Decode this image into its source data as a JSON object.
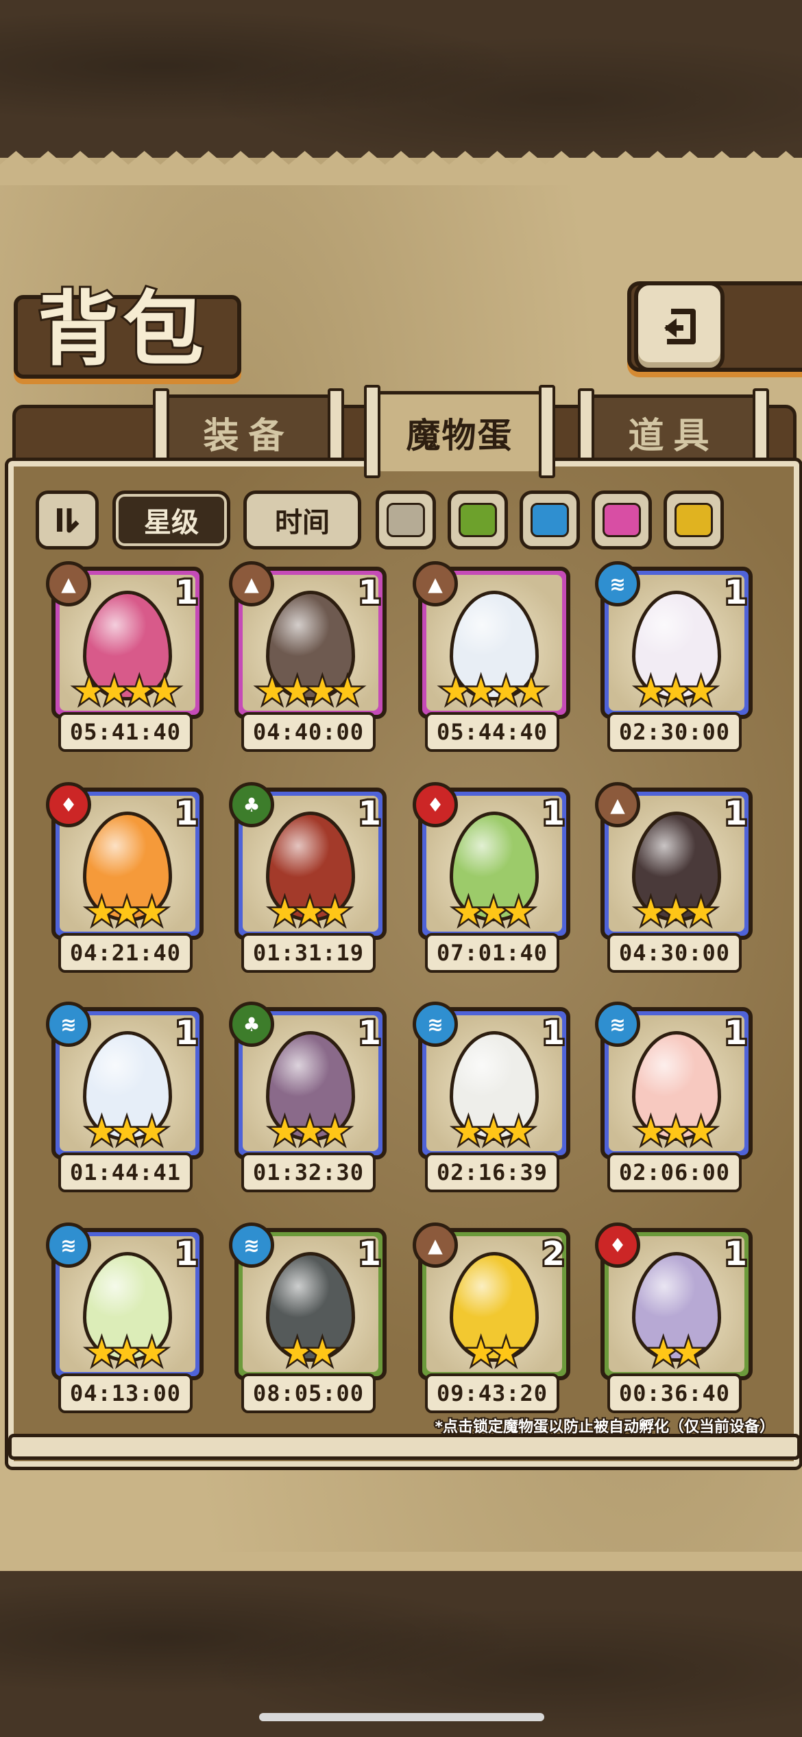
{
  "title": "背包",
  "tabs": [
    {
      "label": "装备",
      "active": false
    },
    {
      "label": "魔物蛋",
      "active": true
    },
    {
      "label": "道具",
      "active": false
    }
  ],
  "sort": {
    "star_label": "星级",
    "time_label": "时间",
    "active": "星级"
  },
  "color_filters": [
    "#b5ab95",
    "#6da12c",
    "#2f8fd0",
    "#d84ea4",
    "#e0b320"
  ],
  "rarity_colors": {
    "purple": "#c54bb7",
    "blue": "#4f63d8",
    "green": "#6c9a3b"
  },
  "element_colors": {
    "earth": "#8c5a3c",
    "water": "#2f8fd0",
    "fire": "#cc2626",
    "grass": "#3d7d2b"
  },
  "eggs": [
    {
      "element": "earth",
      "rarity": "purple",
      "count": "1",
      "stars": 4,
      "time": "05:41:40",
      "egg_color": "#d85a8a"
    },
    {
      "element": "earth",
      "rarity": "purple",
      "count": "1",
      "stars": 4,
      "time": "04:40:00",
      "egg_color": "#6e5a50"
    },
    {
      "element": "earth",
      "rarity": "purple",
      "count": "",
      "stars": 4,
      "time": "05:44:40",
      "egg_color": "#e8eef5"
    },
    {
      "element": "water",
      "rarity": "blue",
      "count": "1",
      "stars": 3,
      "time": "02:30:00",
      "egg_color": "#f2ecf4"
    },
    {
      "element": "fire",
      "rarity": "blue",
      "count": "1",
      "stars": 3,
      "time": "04:21:40",
      "egg_color": "#f59a3a"
    },
    {
      "element": "grass",
      "rarity": "blue",
      "count": "1",
      "stars": 3,
      "time": "01:31:19",
      "egg_color": "#a33a2a"
    },
    {
      "element": "fire",
      "rarity": "blue",
      "count": "1",
      "stars": 3,
      "time": "07:01:40",
      "egg_color": "#9ccb6a"
    },
    {
      "element": "earth",
      "rarity": "blue",
      "count": "1",
      "stars": 3,
      "time": "04:30:00",
      "egg_color": "#4a3a3a"
    },
    {
      "element": "water",
      "rarity": "blue",
      "count": "1",
      "stars": 3,
      "time": "01:44:41",
      "egg_color": "#e6eef8"
    },
    {
      "element": "grass",
      "rarity": "blue",
      "count": "1",
      "stars": 3,
      "time": "01:32:30",
      "egg_color": "#8a6a8a"
    },
    {
      "element": "water",
      "rarity": "blue",
      "count": "1",
      "stars": 3,
      "time": "02:16:39",
      "egg_color": "#eeeeea"
    },
    {
      "element": "water",
      "rarity": "blue",
      "count": "1",
      "stars": 3,
      "time": "02:06:00",
      "egg_color": "#f7c9c0"
    },
    {
      "element": "water",
      "rarity": "blue",
      "count": "1",
      "stars": 3,
      "time": "04:13:00",
      "egg_color": "#dcedb8"
    },
    {
      "element": "water",
      "rarity": "green",
      "count": "1",
      "stars": 2,
      "time": "08:05:00",
      "egg_color": "#555a5a"
    },
    {
      "element": "earth",
      "rarity": "green",
      "count": "2",
      "stars": 2,
      "time": "09:43:20",
      "egg_color": "#f2c830"
    },
    {
      "element": "fire",
      "rarity": "green",
      "count": "1",
      "stars": 2,
      "time": "00:36:40",
      "egg_color": "#b7a9d4"
    }
  ],
  "note": "*点击锁定魔物蛋以防止被自动孵化（仅当前设备）"
}
